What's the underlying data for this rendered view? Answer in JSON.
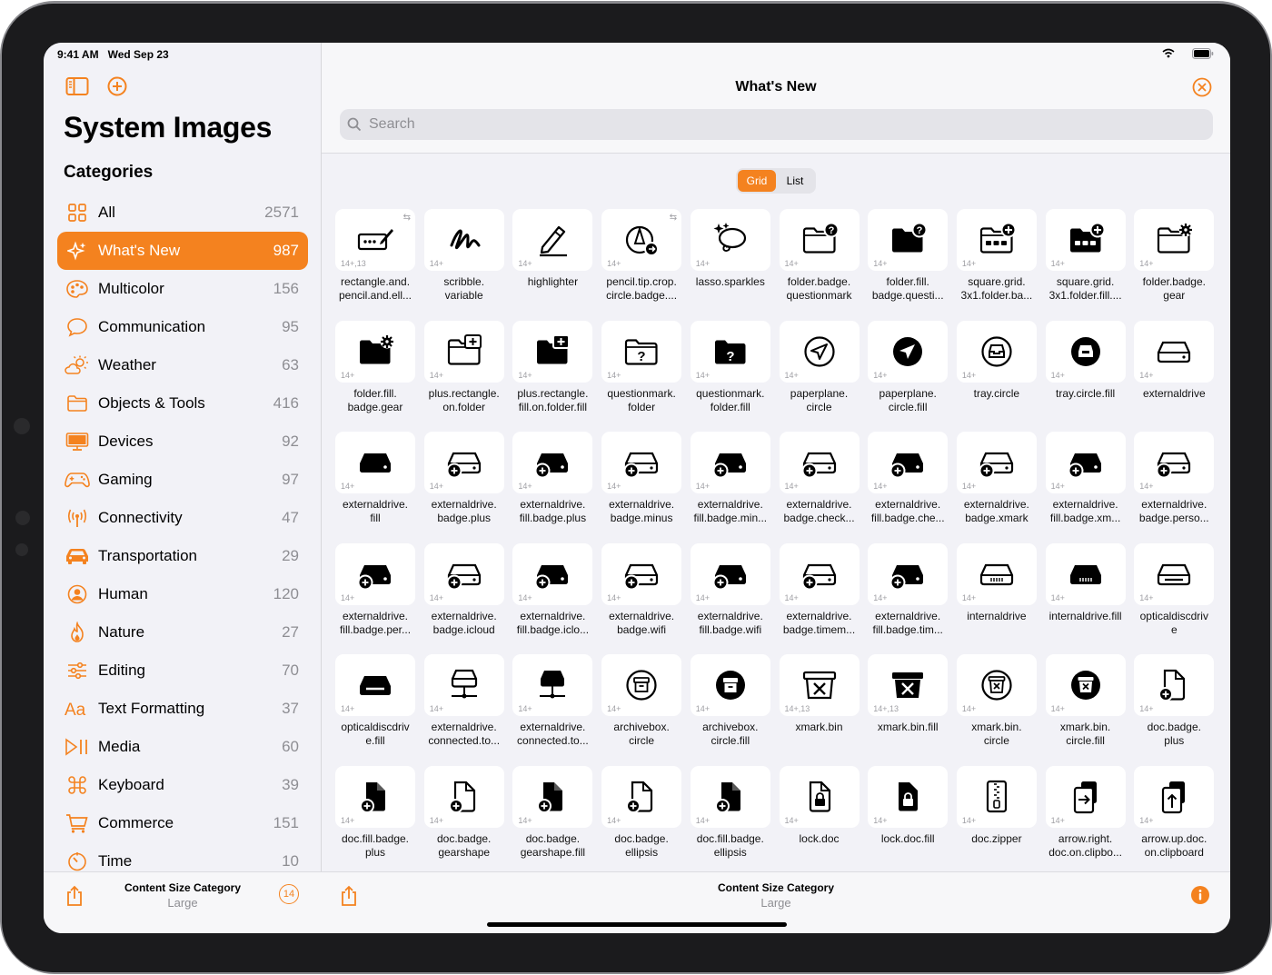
{
  "status": {
    "time": "9:41 AM",
    "date": "Wed Sep 23"
  },
  "sidebar": {
    "title": "System Images",
    "categories_header": "Categories",
    "categories": [
      {
        "label": "All",
        "count": "2571",
        "icon": "grid-icon"
      },
      {
        "label": "What's New",
        "count": "987",
        "icon": "sparkle-icon",
        "active": true
      },
      {
        "label": "Multicolor",
        "count": "156",
        "icon": "palette-icon"
      },
      {
        "label": "Communication",
        "count": "95",
        "icon": "bubble-icon"
      },
      {
        "label": "Weather",
        "count": "63",
        "icon": "cloud-sun-icon"
      },
      {
        "label": "Objects & Tools",
        "count": "416",
        "icon": "folder-icon"
      },
      {
        "label": "Devices",
        "count": "92",
        "icon": "display-icon"
      },
      {
        "label": "Gaming",
        "count": "97",
        "icon": "gamecontroller-icon"
      },
      {
        "label": "Connectivity",
        "count": "47",
        "icon": "antenna-icon"
      },
      {
        "label": "Transportation",
        "count": "29",
        "icon": "car-icon"
      },
      {
        "label": "Human",
        "count": "120",
        "icon": "person-circle-icon"
      },
      {
        "label": "Nature",
        "count": "27",
        "icon": "flame-icon"
      },
      {
        "label": "Editing",
        "count": "70",
        "icon": "sliders-icon"
      },
      {
        "label": "Text Formatting",
        "count": "37",
        "icon": "textformat-icon"
      },
      {
        "label": "Media",
        "count": "60",
        "icon": "playpause-icon"
      },
      {
        "label": "Keyboard",
        "count": "39",
        "icon": "command-icon"
      },
      {
        "label": "Commerce",
        "count": "151",
        "icon": "cart-icon"
      },
      {
        "label": "Time",
        "count": "10",
        "icon": "timer-icon"
      }
    ],
    "footer": {
      "title": "Content Size Category",
      "value": "Large",
      "badge": "14"
    }
  },
  "main": {
    "title": "What's New",
    "search_placeholder": "Search",
    "segments": [
      "Grid",
      "List"
    ],
    "footer": {
      "title": "Content Size Category",
      "value": "Large"
    },
    "symbols": [
      {
        "name": "rectangle.and.\npencil.and.ell...",
        "ver": "14+,13",
        "swap": true,
        "glyph": "kbd"
      },
      {
        "name": "scribble.\nvariable",
        "ver": "14+",
        "glyph": "scribble"
      },
      {
        "name": "highlighter",
        "ver": "14+",
        "glyph": "pen"
      },
      {
        "name": "pencil.tip.crop.\ncircle.badge....",
        "ver": "14+",
        "swap": true,
        "glyph": "pencilcircle"
      },
      {
        "name": "lasso.sparkles",
        "ver": "14+",
        "glyph": "lasso"
      },
      {
        "name": "folder.badge.\nquestionmark",
        "ver": "14+",
        "glyph": "folder-o-q"
      },
      {
        "name": "folder.fill.\nbadge.questi...",
        "ver": "14+",
        "glyph": "folder-f-q"
      },
      {
        "name": "square.grid.\n3x1.folder.ba...",
        "ver": "14+",
        "glyph": "folder-o-grid"
      },
      {
        "name": "square.grid.\n3x1.folder.fill....",
        "ver": "14+",
        "glyph": "folder-f-grid"
      },
      {
        "name": "folder.badge.\ngear",
        "ver": "14+",
        "glyph": "folder-o-gear"
      },
      {
        "name": "folder.fill.\nbadge.gear",
        "ver": "14+",
        "glyph": "folder-f-gear"
      },
      {
        "name": "plus.rectangle.\non.folder",
        "ver": "14+",
        "glyph": "folder-o-plus"
      },
      {
        "name": "plus.rectangle.\nfill.on.folder.fill",
        "ver": "14+",
        "glyph": "folder-f-plus"
      },
      {
        "name": "questionmark.\nfolder",
        "ver": "14+",
        "glyph": "folder-o-qin"
      },
      {
        "name": "questionmark.\nfolder.fill",
        "ver": "14+",
        "glyph": "folder-f-qin"
      },
      {
        "name": "paperplane.\ncircle",
        "ver": "14+",
        "glyph": "plane-o"
      },
      {
        "name": "paperplane.\ncircle.fill",
        "ver": "14+",
        "glyph": "plane-f"
      },
      {
        "name": "tray.circle",
        "ver": "14+",
        "glyph": "tray-o"
      },
      {
        "name": "tray.circle.fill",
        "ver": "14+",
        "glyph": "tray-f"
      },
      {
        "name": "externaldrive",
        "ver": "14+",
        "glyph": "drive-o"
      },
      {
        "name": "externaldrive.\nfill",
        "ver": "14+",
        "glyph": "drive-f"
      },
      {
        "name": "externaldrive.\nbadge.plus",
        "ver": "14+",
        "glyph": "drive-o-b"
      },
      {
        "name": "externaldrive.\nfill.badge.plus",
        "ver": "14+",
        "glyph": "drive-f-b"
      },
      {
        "name": "externaldrive.\nbadge.minus",
        "ver": "14+",
        "glyph": "drive-o-b"
      },
      {
        "name": "externaldrive.\nfill.badge.min...",
        "ver": "14+",
        "glyph": "drive-f-b"
      },
      {
        "name": "externaldrive.\nbadge.check...",
        "ver": "14+",
        "glyph": "drive-o-b"
      },
      {
        "name": "externaldrive.\nfill.badge.che...",
        "ver": "14+",
        "glyph": "drive-f-b"
      },
      {
        "name": "externaldrive.\nbadge.xmark",
        "ver": "14+",
        "glyph": "drive-o-b"
      },
      {
        "name": "externaldrive.\nfill.badge.xm...",
        "ver": "14+",
        "glyph": "drive-f-b"
      },
      {
        "name": "externaldrive.\nbadge.perso...",
        "ver": "14+",
        "glyph": "drive-o-b"
      },
      {
        "name": "externaldrive.\nfill.badge.per...",
        "ver": "14+",
        "glyph": "drive-f-b"
      },
      {
        "name": "externaldrive.\nbadge.icloud",
        "ver": "14+",
        "glyph": "drive-o-b"
      },
      {
        "name": "externaldrive.\nfill.badge.iclo...",
        "ver": "14+",
        "glyph": "drive-f-b"
      },
      {
        "name": "externaldrive.\nbadge.wifi",
        "ver": "14+",
        "glyph": "drive-o-b"
      },
      {
        "name": "externaldrive.\nfill.badge.wifi",
        "ver": "14+",
        "glyph": "drive-f-b"
      },
      {
        "name": "externaldrive.\nbadge.timem...",
        "ver": "14+",
        "glyph": "drive-o-b"
      },
      {
        "name": "externaldrive.\nfill.badge.tim...",
        "ver": "14+",
        "glyph": "drive-f-b"
      },
      {
        "name": "internaldrive",
        "ver": "14+",
        "glyph": "idrive-o"
      },
      {
        "name": "internaldrive.fill",
        "ver": "14+",
        "glyph": "idrive-f"
      },
      {
        "name": "opticaldiscdriv\ne",
        "ver": "14+",
        "glyph": "odrive-o"
      },
      {
        "name": "opticaldiscdriv\ne.fill",
        "ver": "14+",
        "glyph": "odrive-f"
      },
      {
        "name": "externaldrive.\nconnected.to...",
        "ver": "14+",
        "glyph": "drive-net-o"
      },
      {
        "name": "externaldrive.\nconnected.to...",
        "ver": "14+",
        "glyph": "drive-net-f"
      },
      {
        "name": "archivebox.\ncircle",
        "ver": "14+",
        "glyph": "archive-o"
      },
      {
        "name": "archivebox.\ncircle.fill",
        "ver": "14+",
        "glyph": "archive-f"
      },
      {
        "name": "xmark.bin",
        "ver": "14+,13",
        "glyph": "bin-o"
      },
      {
        "name": "xmark.bin.fill",
        "ver": "14+,13",
        "glyph": "bin-f"
      },
      {
        "name": "xmark.bin.\ncircle",
        "ver": "14+",
        "glyph": "bincircle-o"
      },
      {
        "name": "xmark.bin.\ncircle.fill",
        "ver": "14+",
        "glyph": "bincircle-f"
      },
      {
        "name": "doc.badge.\nplus",
        "ver": "14+",
        "glyph": "doc-o-b"
      },
      {
        "name": "doc.fill.badge.\nplus",
        "ver": "14+",
        "glyph": "doc-f-b"
      },
      {
        "name": "doc.badge.\ngearshape",
        "ver": "14+",
        "glyph": "doc-o-b"
      },
      {
        "name": "doc.badge.\ngearshape.fill",
        "ver": "14+",
        "glyph": "doc-f-b"
      },
      {
        "name": "doc.badge.\nellipsis",
        "ver": "14+",
        "glyph": "doc-o-b"
      },
      {
        "name": "doc.fill.badge.\nellipsis",
        "ver": "14+",
        "glyph": "doc-f-b"
      },
      {
        "name": "lock.doc",
        "ver": "14+",
        "glyph": "lockdoc-o"
      },
      {
        "name": "lock.doc.fill",
        "ver": "14+",
        "glyph": "lockdoc-f"
      },
      {
        "name": "doc.zipper",
        "ver": "14+",
        "glyph": "zipper"
      },
      {
        "name": "arrow.right.\ndoc.on.clipbo...",
        "ver": "14+",
        "glyph": "clip-right"
      },
      {
        "name": "arrow.up.doc.\non.clipboard",
        "ver": "14+",
        "glyph": "clip-up"
      }
    ]
  },
  "colors": {
    "accent": "#f4821f",
    "background": "#f2f2f7"
  }
}
